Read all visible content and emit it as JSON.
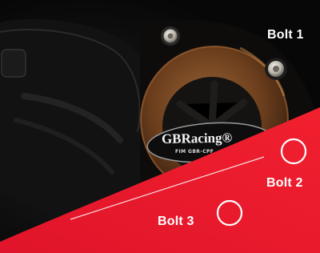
{
  "image": {
    "subject": "motorcycle-engine-cover-close-up",
    "colors": {
      "background_dark": "#0b0b0c",
      "cover_dark": "#141414",
      "bronze_cover": "#7a4a24",
      "bolt_silver": "#c9c6bf",
      "red_banner": "#ee1b2c",
      "marker_white": "#ffffff"
    }
  },
  "brand": {
    "logo_text": "GBRacing",
    "logo_registered_mark": "®",
    "sub_text": "FIM GBR-CPF"
  },
  "callouts": {
    "bolt1": "Bolt 1",
    "bolt2": "Bolt 2",
    "bolt3": "Bolt 3"
  }
}
